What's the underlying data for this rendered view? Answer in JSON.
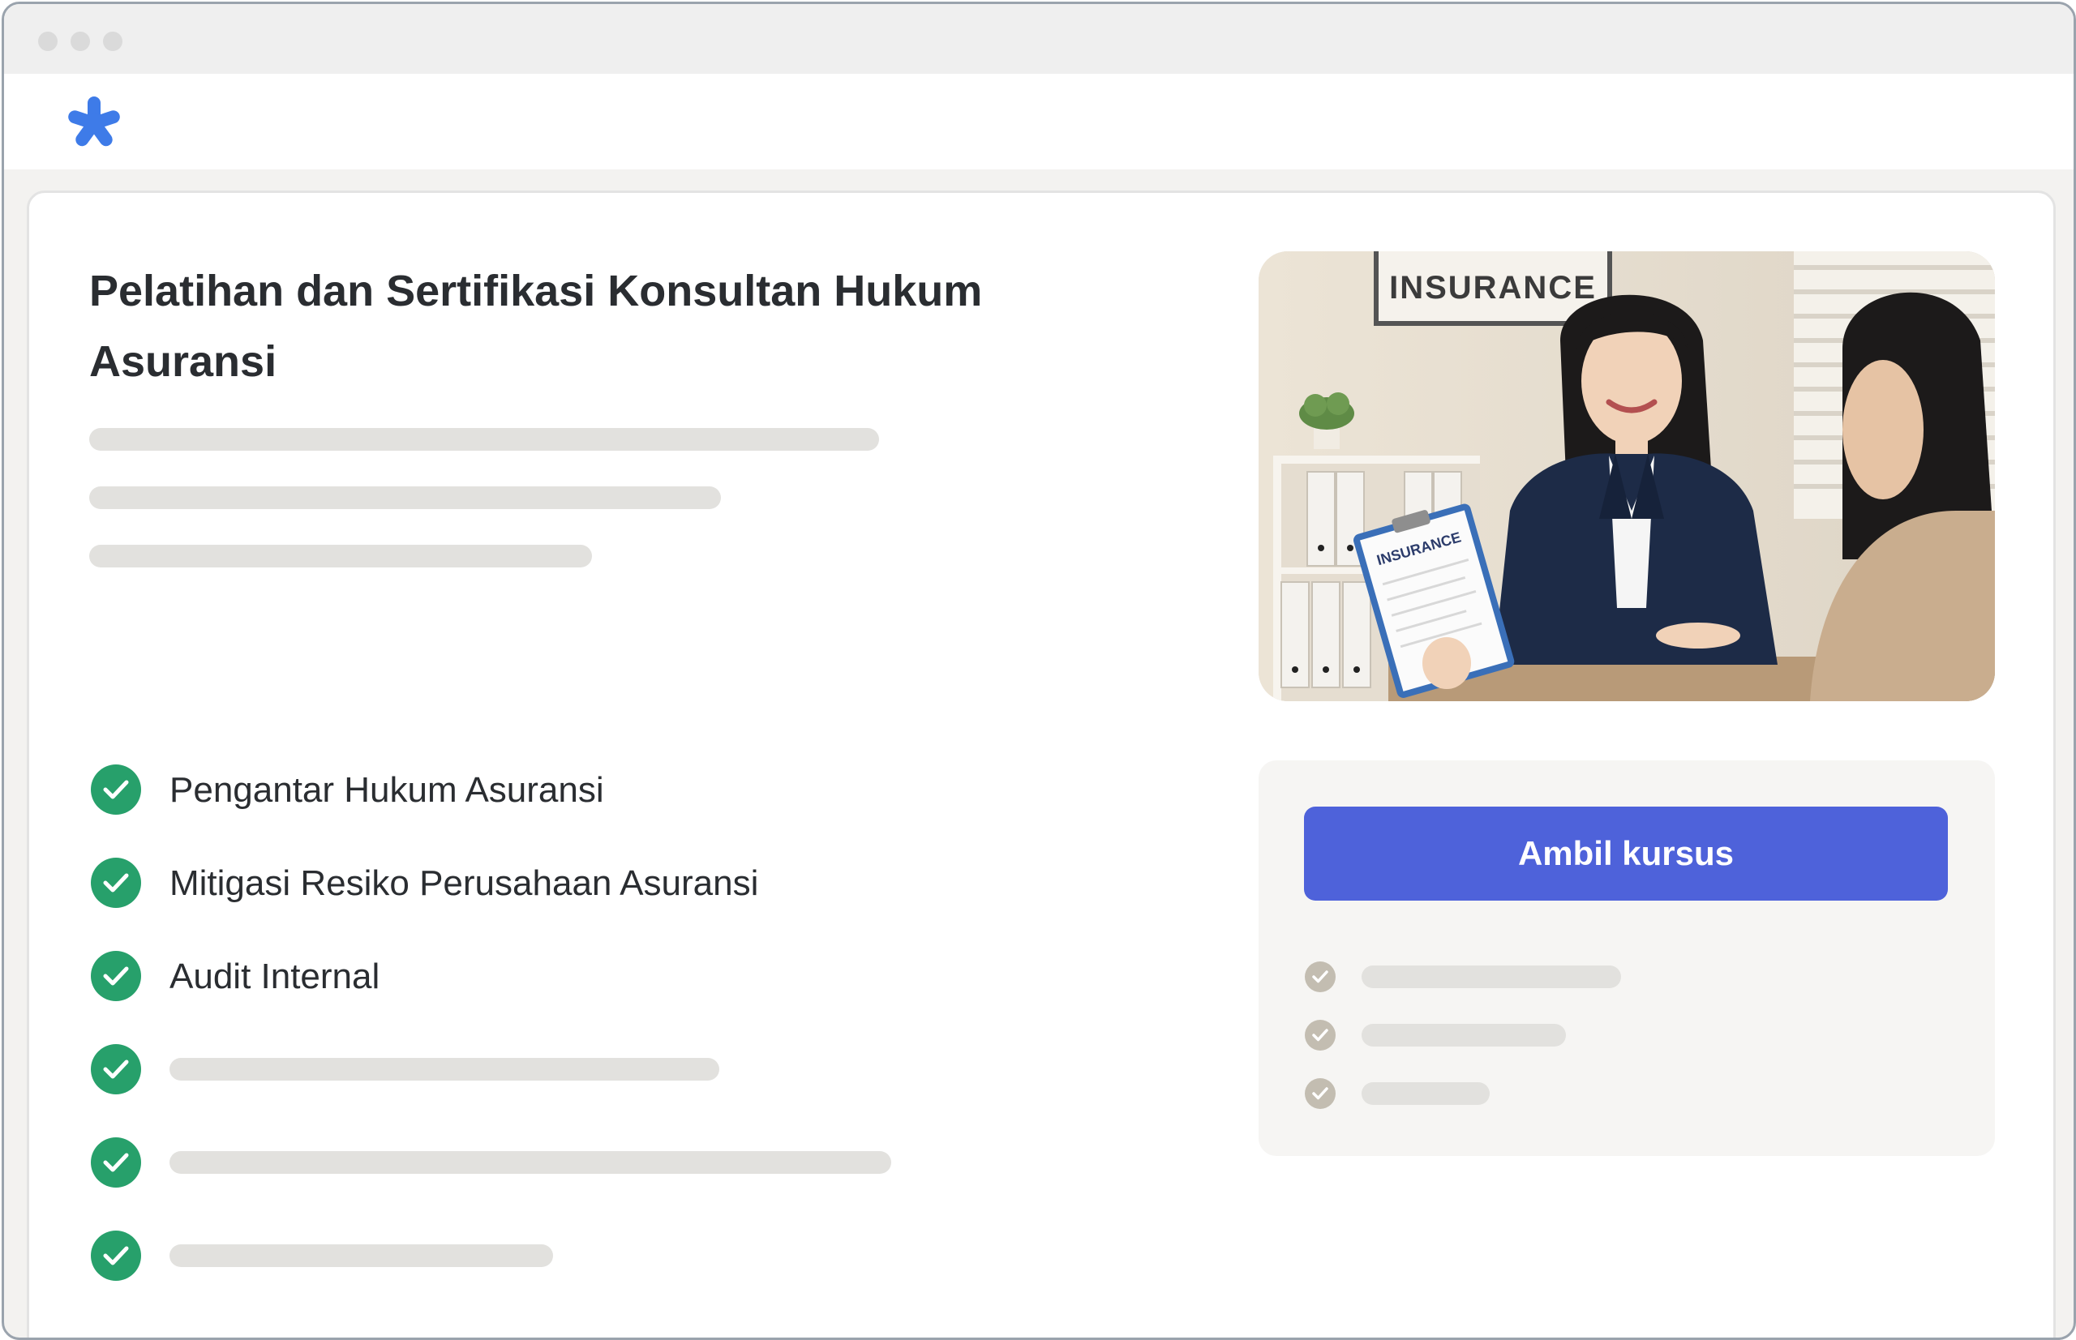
{
  "window": {
    "controls": [
      "window-dot",
      "window-dot",
      "window-dot"
    ]
  },
  "app": {
    "logo_icon": "asterisk-logo-icon",
    "brand_color": "#3e7be8"
  },
  "course": {
    "title": "Pelatihan dan Sertifikasi Konsultan Hukum Asuransi",
    "features": [
      {
        "label": "Pengantar Hukum Asuransi"
      },
      {
        "label": "Mitigasi Resiko Perusahaan Asuransi"
      },
      {
        "label": "Audit Internal"
      }
    ],
    "check_color": "#27a06b"
  },
  "hero_image": {
    "sign_text": "INSURANCE",
    "clipboard_text": "INSURANCE"
  },
  "enroll_panel": {
    "button_label": "Ambil kursus",
    "button_color": "#4e62da"
  }
}
